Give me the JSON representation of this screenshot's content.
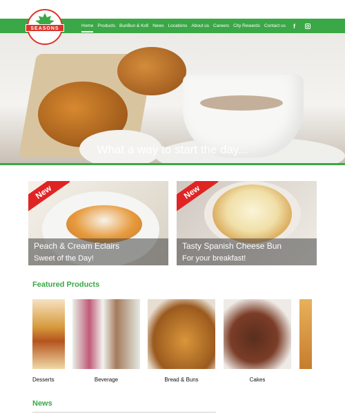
{
  "brand": {
    "logo_text": "SEASONS"
  },
  "nav": {
    "items": [
      {
        "label": "Home",
        "active": true
      },
      {
        "label": "Products"
      },
      {
        "label": "BunBun & Kofi"
      },
      {
        "label": "News"
      },
      {
        "label": "Locations"
      },
      {
        "label": "About us"
      },
      {
        "label": "Careers"
      },
      {
        "label": "City Rewards"
      },
      {
        "label": "Contact us"
      }
    ],
    "social": {
      "facebook_glyph": "f",
      "instagram_glyph": "◘"
    }
  },
  "hero": {
    "caption": "What a way to start the day..."
  },
  "promos": [
    {
      "badge": "New",
      "title": "Peach & Cream Eclairs",
      "subtitle": "Sweet of the Day!"
    },
    {
      "badge": "New",
      "title": "Tasty Spanish Cheese Bun",
      "subtitle": "For your breakfast!"
    }
  ],
  "featured": {
    "title": "Featured Products",
    "items": [
      {
        "label": "Desserts"
      },
      {
        "label": "Beverage"
      },
      {
        "label": "Bread & Buns"
      },
      {
        "label": "Cakes"
      }
    ]
  },
  "news": {
    "title": "News"
  },
  "colors": {
    "brand_green": "#3aa846",
    "badge_red": "#e02424",
    "logo_red": "#d9342b"
  }
}
